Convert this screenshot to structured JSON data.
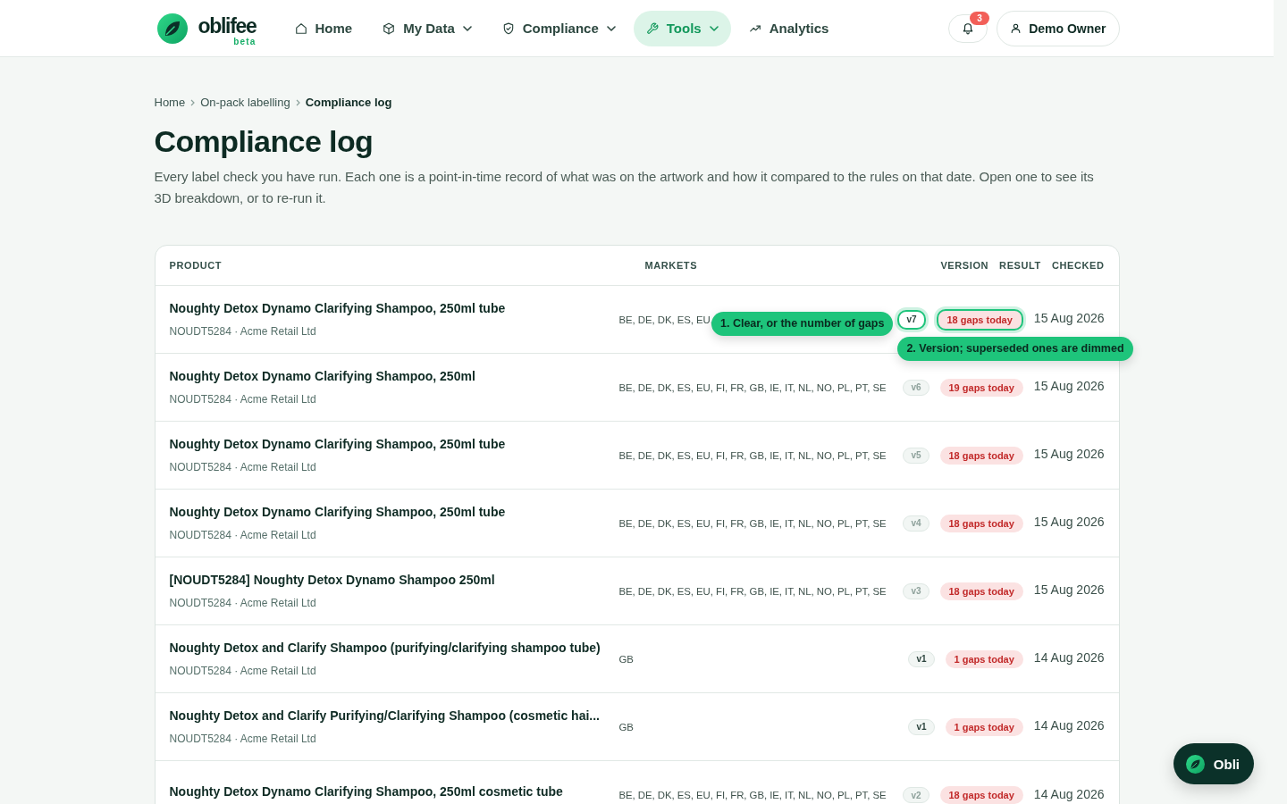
{
  "brand": {
    "name": "oblifee",
    "tag": "beta"
  },
  "nav": [
    {
      "label": "Home",
      "selected": false,
      "dropdown": false
    },
    {
      "label": "My Data",
      "selected": false,
      "dropdown": true
    },
    {
      "label": "Compliance",
      "selected": false,
      "dropdown": true
    },
    {
      "label": "Tools",
      "selected": true,
      "dropdown": true
    },
    {
      "label": "Analytics",
      "selected": false,
      "dropdown": false
    }
  ],
  "notifications": {
    "count": "3"
  },
  "account": {
    "label": "Demo Owner"
  },
  "breadcrumb": [
    {
      "label": "Home",
      "current": false
    },
    {
      "label": "On-pack labelling",
      "current": false
    },
    {
      "label": "Compliance log",
      "current": true
    }
  ],
  "title": "Compliance log",
  "description": "Every label check you have run. Each one is a point-in-time record of what was on the artwork and how it compared to the rules on that date. Open one to see its 3D breakdown, or to re-run it.",
  "table": {
    "columns": [
      "PRODUCT",
      "MARKETS",
      "VERSION",
      "RESULT",
      "CHECKED"
    ],
    "rows": [
      {
        "product": "Noughty Detox Dynamo Clarifying Shampoo, 250ml tube",
        "meta": "NOUDT5284 · Acme Retail Ltd",
        "markets": "BE, DE, DK, ES, EU,",
        "version": {
          "label": "v7",
          "superseded": false,
          "highlighted": true
        },
        "result": {
          "label": "18 gaps today",
          "highlighted": true
        },
        "checked": "15 Aug 2026"
      },
      {
        "product": "Noughty Detox Dynamo Clarifying Shampoo, 250ml",
        "meta": "NOUDT5284 · Acme Retail Ltd",
        "markets": "BE, DE, DK, ES, EU, FI, FR, GB, IE, IT, NL, NO, PL, PT, SE",
        "version": {
          "label": "v6",
          "superseded": true,
          "highlighted": false
        },
        "result": {
          "label": "19 gaps today",
          "highlighted": false
        },
        "checked": "15 Aug 2026"
      },
      {
        "product": "Noughty Detox Dynamo Clarifying Shampoo, 250ml tube",
        "meta": "NOUDT5284 · Acme Retail Ltd",
        "markets": "BE, DE, DK, ES, EU, FI, FR, GB, IE, IT, NL, NO, PL, PT, SE",
        "version": {
          "label": "v5",
          "superseded": true,
          "highlighted": false
        },
        "result": {
          "label": "18 gaps today",
          "highlighted": false
        },
        "checked": "15 Aug 2026"
      },
      {
        "product": "Noughty Detox Dynamo Clarifying Shampoo, 250ml tube",
        "meta": "NOUDT5284 · Acme Retail Ltd",
        "markets": "BE, DE, DK, ES, EU, FI, FR, GB, IE, IT, NL, NO, PL, PT, SE",
        "version": {
          "label": "v4",
          "superseded": true,
          "highlighted": false
        },
        "result": {
          "label": "18 gaps today",
          "highlighted": false
        },
        "checked": "15 Aug 2026"
      },
      {
        "product": "[NOUDT5284] Noughty Detox Dynamo Shampoo 250ml",
        "meta": "NOUDT5284 · Acme Retail Ltd",
        "markets": "BE, DE, DK, ES, EU, FI, FR, GB, IE, IT, NL, NO, PL, PT, SE",
        "version": {
          "label": "v3",
          "superseded": true,
          "highlighted": false
        },
        "result": {
          "label": "18 gaps today",
          "highlighted": false
        },
        "checked": "15 Aug 2026"
      },
      {
        "product": "Noughty Detox and Clarify Shampoo (purifying/clarifying shampoo tube)",
        "meta": "NOUDT5284 · Acme Retail Ltd",
        "markets": "GB",
        "version": {
          "label": "v1",
          "superseded": false,
          "highlighted": false
        },
        "result": {
          "label": "1 gaps today",
          "highlighted": false
        },
        "checked": "14 Aug 2026"
      },
      {
        "product": "Noughty Detox and Clarify Purifying/Clarifying Shampoo (cosmetic hai...",
        "meta": "NOUDT5284 · Acme Retail Ltd",
        "markets": "GB",
        "version": {
          "label": "v1",
          "superseded": false,
          "highlighted": false
        },
        "result": {
          "label": "1 gaps today",
          "highlighted": false
        },
        "checked": "14 Aug 2026"
      },
      {
        "product": "Noughty Detox Dynamo Clarifying Shampoo, 250ml cosmetic tube",
        "markets": "BE, DE, DK, ES, EU, FI, FR, GB, IE, IT, NL, NO, PL, PT, SE",
        "version": {
          "label": "v2",
          "superseded": true,
          "highlighted": false
        },
        "result": {
          "label": "18 gaps today",
          "highlighted": false
        },
        "checked": "14 Aug 2026"
      }
    ]
  },
  "tour": {
    "steps": [
      {
        "text": "1. Clear, or the number of gaps"
      },
      {
        "text": "2. Version; superseded ones are dimmed"
      }
    ]
  },
  "assistant": {
    "label": "Obli"
  }
}
